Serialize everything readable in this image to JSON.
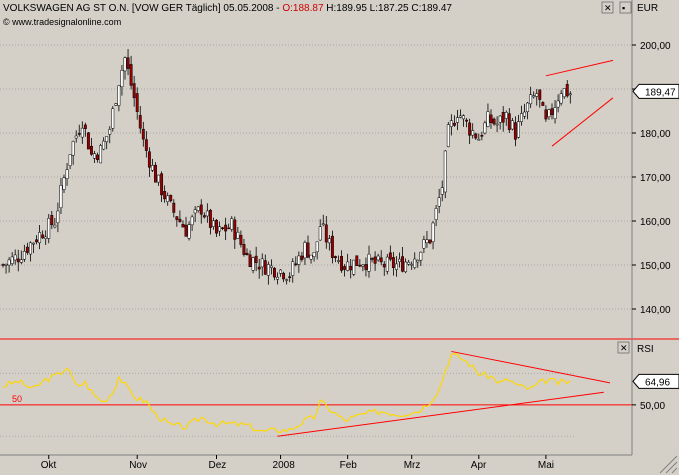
{
  "header": {
    "title_prefix": "VOLKSWAGEN AG ST O.N. [VOW GER  Täglich] 05.05.2008 - ",
    "open": "O:188.87",
    "hlc": " H:189.95 L:187.25 C:189.47",
    "copyright": "© www.tradesignalonline.com"
  },
  "colors": {
    "panel_bg": "#d4d0c8",
    "up_candle": "#ffffff",
    "down_candle": "#990000",
    "trendline": "#ff0000",
    "rsi_line": "#ffd700",
    "separator": "#ff0000"
  },
  "icons": {
    "close": "close-icon",
    "expand": "expand-icon"
  },
  "chart_data": [
    {
      "type": "candlestick",
      "title": "VOLKSWAGEN AG ST O.N. [VOW GER  Täglich] 05.05.2008",
      "ylabel": "EUR",
      "ylim": [
        130,
        205
      ],
      "yticks": [
        "140,00",
        "150,00",
        "160,00",
        "170,00",
        "180,00",
        "190,00",
        "200,00"
      ],
      "x_labels": [
        "Okt",
        "Nov",
        "Dez",
        "2008",
        "Feb",
        "Mrz",
        "Apr",
        "Mai"
      ],
      "last_value_label": "189,47",
      "grid": true,
      "anchors_index_price": [
        [
          0,
          150
        ],
        [
          5,
          152
        ],
        [
          12,
          157
        ],
        [
          17,
          160
        ],
        [
          22,
          176
        ],
        [
          26,
          183
        ],
        [
          29,
          175
        ],
        [
          32,
          176
        ],
        [
          35,
          181
        ],
        [
          38,
          192
        ],
        [
          40,
          197
        ],
        [
          43,
          188
        ],
        [
          46,
          178
        ],
        [
          50,
          170
        ],
        [
          55,
          163
        ],
        [
          60,
          158
        ],
        [
          65,
          163
        ],
        [
          70,
          157
        ],
        [
          75,
          159
        ],
        [
          80,
          152
        ],
        [
          85,
          150
        ],
        [
          90,
          149
        ],
        [
          94,
          148
        ],
        [
          99,
          154
        ],
        [
          102,
          152
        ],
        [
          104,
          159
        ],
        [
          108,
          153
        ],
        [
          112,
          150
        ],
        [
          118,
          151
        ],
        [
          124,
          150
        ],
        [
          130,
          150
        ],
        [
          135,
          152
        ],
        [
          140,
          156
        ],
        [
          144,
          168
        ],
        [
          146,
          180
        ],
        [
          149,
          185
        ],
        [
          153,
          181
        ],
        [
          156,
          179
        ],
        [
          159,
          183
        ],
        [
          162,
          182
        ],
        [
          165,
          184
        ],
        [
          168,
          180
        ],
        [
          172,
          186
        ],
        [
          175,
          189
        ],
        [
          178,
          182
        ],
        [
          180,
          185
        ],
        [
          183,
          190
        ],
        [
          186,
          189
        ]
      ],
      "trendlines": [
        {
          "from": [
            178,
            193
          ],
          "to": [
            200,
            196.5
          ]
        },
        {
          "from": [
            180,
            177
          ],
          "to": [
            200,
            188
          ]
        }
      ]
    },
    {
      "type": "line",
      "title": "RSI",
      "series": [
        {
          "name": "RSI",
          "points": [
            [
              0,
              62
            ],
            [
              5,
              65
            ],
            [
              10,
              60
            ],
            [
              14,
              66
            ],
            [
              18,
              69
            ],
            [
              21,
              74
            ],
            [
              24,
              62
            ],
            [
              27,
              64
            ],
            [
              30,
              56
            ],
            [
              33,
              52
            ],
            [
              36,
              58
            ],
            [
              38,
              68
            ],
            [
              41,
              60
            ],
            [
              44,
              54
            ],
            [
              47,
              52
            ],
            [
              50,
              44
            ],
            [
              55,
              37
            ],
            [
              60,
              36
            ],
            [
              65,
              42
            ],
            [
              70,
              38
            ],
            [
              75,
              38
            ],
            [
              80,
              37
            ],
            [
              85,
              33
            ],
            [
              90,
              34
            ],
            [
              94,
              34
            ],
            [
              99,
              40
            ],
            [
              102,
              42
            ],
            [
              104,
              52
            ],
            [
              108,
              46
            ],
            [
              112,
              40
            ],
            [
              118,
              44
            ],
            [
              124,
              46
            ],
            [
              130,
              44
            ],
            [
              136,
              46
            ],
            [
              140,
              52
            ],
            [
              143,
              60
            ],
            [
              145,
              72
            ],
            [
              147,
              82
            ],
            [
              150,
              80
            ],
            [
              153,
              76
            ],
            [
              156,
              70
            ],
            [
              160,
              68
            ],
            [
              163,
              64
            ],
            [
              166,
              66
            ],
            [
              169,
              62
            ],
            [
              173,
              60
            ],
            [
              176,
              64
            ],
            [
              179,
              66
            ],
            [
              182,
              64
            ],
            [
              186,
              65
            ]
          ]
        }
      ],
      "ylim": [
        20,
        90
      ],
      "yticks": [
        "50,00"
      ],
      "hline": {
        "value": 50,
        "label": "50"
      },
      "last_value_label": "64,96",
      "trendlines": [
        {
          "from": [
            147,
            84
          ],
          "to": [
            199,
            64
          ]
        },
        {
          "from": [
            90,
            30
          ],
          "to": [
            197,
            58
          ]
        }
      ]
    }
  ]
}
